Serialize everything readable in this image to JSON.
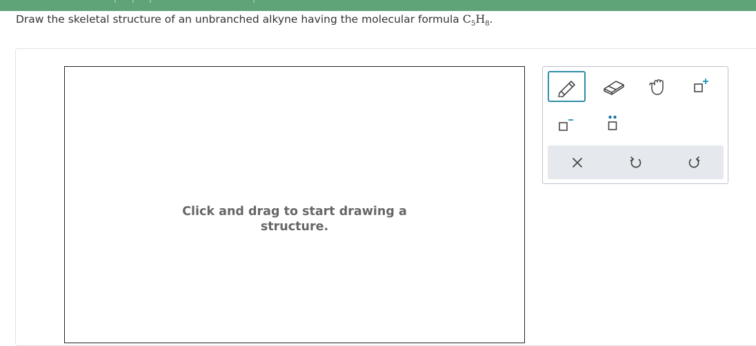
{
  "question": {
    "text_before": "Draw the skeletal structure of an unbranched alkyne having the molecular formula ",
    "formula_c": "C",
    "formula_c_sub": "5",
    "formula_h": "H",
    "formula_h_sub": "8",
    "period": "."
  },
  "canvas": {
    "hint_line1": "Click and drag to start drawing a",
    "hint_line2": "structure."
  },
  "toolbox": {
    "tools": [
      "pencil-icon",
      "eraser-icon",
      "hand-icon",
      "positive-charge-icon",
      "negative-charge-icon",
      "lone-pair-icon"
    ],
    "actions": [
      "clear-icon",
      "undo-icon",
      "redo-icon"
    ],
    "accent_color": "#2d8ca4",
    "charge_color": "#1a8fb6"
  },
  "colors": {
    "top_bar": "#5fa478"
  }
}
